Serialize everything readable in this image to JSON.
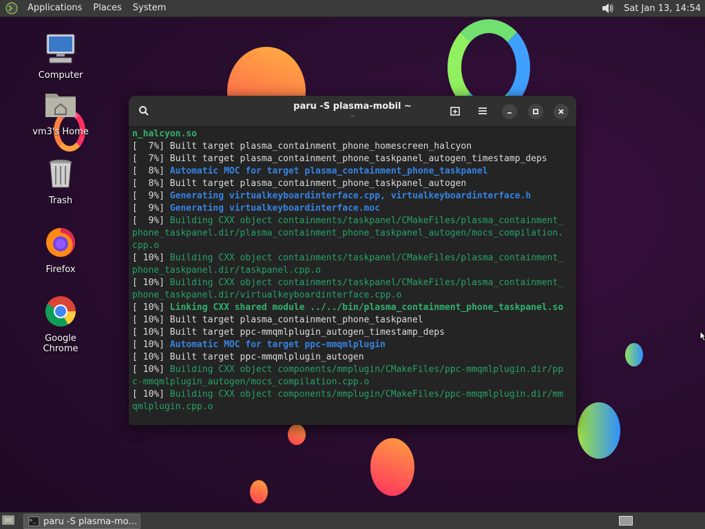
{
  "top_panel": {
    "menus": [
      "Applications",
      "Places",
      "System"
    ],
    "clock": "Sat Jan 13, 14:54"
  },
  "desktop_icons": [
    {
      "label": "Computer",
      "icon": "computer-icon"
    },
    {
      "label": "vm3's Home",
      "icon": "home-folder-icon"
    },
    {
      "label": "Trash",
      "icon": "trash-icon"
    },
    {
      "label": "Firefox",
      "icon": "firefox-icon"
    },
    {
      "label": "Google Chrome",
      "icon": "chrome-icon"
    }
  ],
  "terminal": {
    "title": "paru -S plasma-mobil ~",
    "subtitle": "~",
    "lines": [
      [
        {
          "t": "n_halcyon.so",
          "c": "gb"
        }
      ],
      [
        {
          "t": "[  7%] ",
          "c": "w"
        },
        {
          "t": "Built target plasma_containment_phone_homescreen_halcyon",
          "c": "w"
        }
      ],
      [
        {
          "t": "[  7%] ",
          "c": "w"
        },
        {
          "t": "Built target plasma_containment_phone_taskpanel_autogen_timestamp_deps",
          "c": "w"
        }
      ],
      [
        {
          "t": "[  8%] ",
          "c": "w"
        },
        {
          "t": "Automatic MOC for target plasma_containment_phone_taskpanel",
          "c": "b"
        }
      ],
      [
        {
          "t": "[  8%] ",
          "c": "w"
        },
        {
          "t": "Built target plasma_containment_phone_taskpanel_autogen",
          "c": "w"
        }
      ],
      [
        {
          "t": "[  9%] ",
          "c": "w"
        },
        {
          "t": "Generating virtualkeyboardinterface.cpp, virtualkeyboardinterface.h",
          "c": "b"
        }
      ],
      [
        {
          "t": "[  9%] ",
          "c": "w"
        },
        {
          "t": "Generating virtualkeyboardinterface.moc",
          "c": "b"
        }
      ],
      [
        {
          "t": "[  9%] ",
          "c": "w"
        },
        {
          "t": "Building CXX object containments/taskpanel/CMakeFiles/plasma_containment_",
          "c": "g"
        }
      ],
      [
        {
          "t": "phone_taskpanel.dir/plasma_containment_phone_taskpanel_autogen/mocs_compilation.",
          "c": "g"
        }
      ],
      [
        {
          "t": "cpp.o",
          "c": "g"
        }
      ],
      [
        {
          "t": "[ 10%] ",
          "c": "w"
        },
        {
          "t": "Building CXX object containments/taskpanel/CMakeFiles/plasma_containment_",
          "c": "g"
        }
      ],
      [
        {
          "t": "phone_taskpanel.dir/taskpanel.cpp.o",
          "c": "g"
        }
      ],
      [
        {
          "t": "[ 10%] ",
          "c": "w"
        },
        {
          "t": "Building CXX object containments/taskpanel/CMakeFiles/plasma_containment_",
          "c": "g"
        }
      ],
      [
        {
          "t": "phone_taskpanel.dir/virtualkeyboardinterface.cpp.o",
          "c": "g"
        }
      ],
      [
        {
          "t": "[ 10%] ",
          "c": "w"
        },
        {
          "t": "Linking CXX shared module ../../bin/plasma_containment_phone_taskpanel.so",
          "c": "gb"
        }
      ],
      [
        {
          "t": "[ 10%] ",
          "c": "w"
        },
        {
          "t": "Built target plasma_containment_phone_taskpanel",
          "c": "w"
        }
      ],
      [
        {
          "t": "[ 10%] ",
          "c": "w"
        },
        {
          "t": "Built target ppc-mmqmlplugin_autogen_timestamp_deps",
          "c": "w"
        }
      ],
      [
        {
          "t": "[ 10%] ",
          "c": "w"
        },
        {
          "t": "Automatic MOC for target ppc-mmqmlplugin",
          "c": "b"
        }
      ],
      [
        {
          "t": "[ 10%] ",
          "c": "w"
        },
        {
          "t": "Built target ppc-mmqmlplugin_autogen",
          "c": "w"
        }
      ],
      [
        {
          "t": "[ 10%] ",
          "c": "w"
        },
        {
          "t": "Building CXX object components/mmplugin/CMakeFiles/ppc-mmqmlplugin.dir/pp",
          "c": "g"
        }
      ],
      [
        {
          "t": "c-mmqmlplugin_autogen/mocs_compilation.cpp.o",
          "c": "g"
        }
      ],
      [
        {
          "t": "[ 10%] ",
          "c": "w"
        },
        {
          "t": "Building CXX object components/mmplugin/CMakeFiles/ppc-mmqmlplugin.dir/mm",
          "c": "g"
        }
      ],
      [
        {
          "t": "qmlplugin.cpp.o",
          "c": "g"
        }
      ]
    ]
  },
  "taskbar": {
    "task_label": "paru -S plasma-mo…"
  }
}
